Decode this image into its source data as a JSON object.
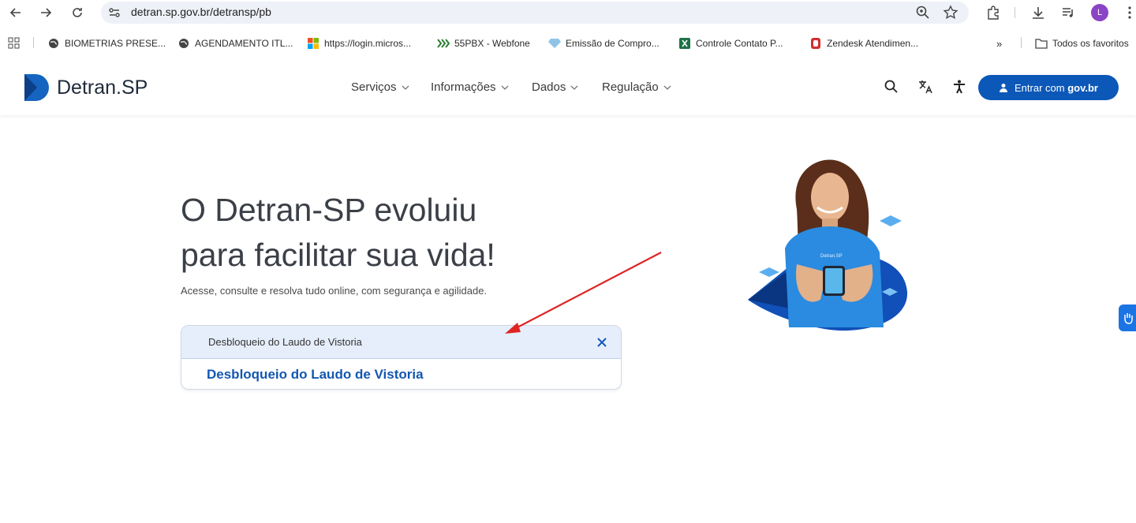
{
  "browser": {
    "url": "detran.sp.gov.br/detransp/pb",
    "profile_initial": "L",
    "bookmarks": [
      {
        "label": "BIOMETRIAS PRESE...",
        "icon": "globe-icon"
      },
      {
        "label": "AGENDAMENTO ITL...",
        "icon": "globe-icon"
      },
      {
        "label": "https://login.micros...",
        "icon": "microsoft-icon"
      },
      {
        "label": "55PBX - Webfone",
        "icon": "pbx-icon"
      },
      {
        "label": "Emissão de Compro...",
        "icon": "diamond-icon"
      },
      {
        "label": "Controle Contato P...",
        "icon": "excel-icon"
      },
      {
        "label": "Zendesk Atendimen...",
        "icon": "zendesk-icon"
      }
    ],
    "overflow_label": "»",
    "all_bookmarks_label": "Todos os favoritos"
  },
  "site": {
    "logo_text_main": "Detran",
    "logo_text_suffix": ".SP",
    "nav": [
      {
        "label": "Serviços"
      },
      {
        "label": "Informações"
      },
      {
        "label": "Dados"
      },
      {
        "label": "Regulação"
      }
    ],
    "login_prefix": "Entrar com ",
    "login_brand": "gov.br",
    "accent_color": "#0c58b8"
  },
  "hero": {
    "title_line1": "O Detran-SP evoluiu",
    "title_line2": "para facilitar sua vida!",
    "subtitle": "Acesse, consulte e resolva tudo online, com segurança e agilidade."
  },
  "search": {
    "value": "Desbloqueio do Laudo de Vistoria",
    "suggestion": "Desbloqueio do Laudo de Vistoria"
  },
  "illustration": {
    "shirt_text": "Detran.SP"
  }
}
